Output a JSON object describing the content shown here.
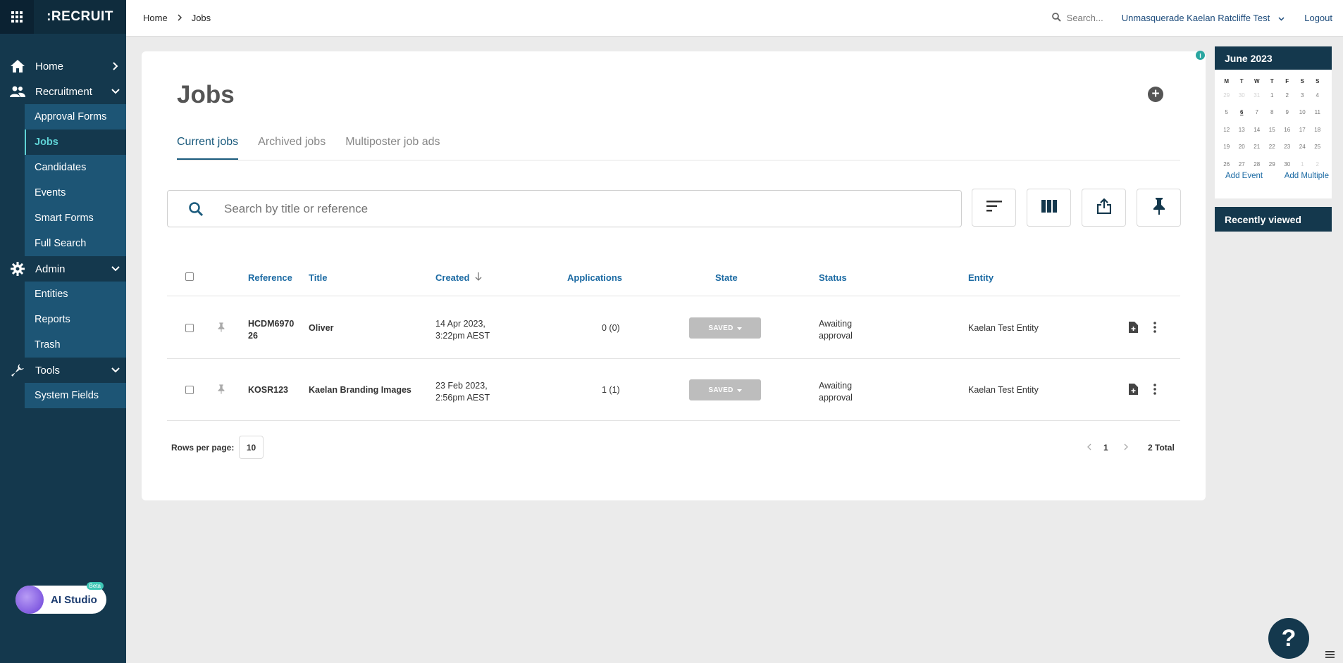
{
  "sidebar": {
    "brand": ":RECRUIT",
    "nav": [
      {
        "label": "Home"
      },
      {
        "label": "Recruitment",
        "children": [
          "Approval Forms",
          "Jobs",
          "Candidates",
          "Events",
          "Smart Forms",
          "Full Search"
        ]
      },
      {
        "label": "Admin",
        "children": [
          "Entities",
          "Reports",
          "Trash"
        ]
      },
      {
        "label": "Tools",
        "children": [
          "System Fields"
        ]
      }
    ],
    "ai_studio": {
      "label": "AI Studio",
      "badge": "Beta"
    }
  },
  "topbar": {
    "breadcrumb": [
      "Home",
      "Jobs"
    ],
    "search_placeholder": "Search...",
    "user": "Unmasquerade Kaelan Ratcliffe Test",
    "logout": "Logout"
  },
  "main": {
    "title": "Jobs",
    "tabs": [
      "Current jobs",
      "Archived jobs",
      "Multiposter job ads"
    ],
    "search_placeholder": "Search by title or reference",
    "columns": [
      "Reference",
      "Title",
      "Created",
      "Applications",
      "State",
      "Status",
      "Entity"
    ],
    "rows": [
      {
        "reference_1": "HCDM6970",
        "reference_2": "26",
        "title": "Oliver",
        "created_1": "14 Apr 2023,",
        "created_2": "3:22pm AEST",
        "applications": "0 (0)",
        "state": "SAVED",
        "status_1": "Awaiting",
        "status_2": "approval",
        "entity": "Kaelan Test Entity"
      },
      {
        "reference_1": "KOSR123",
        "reference_2": "",
        "title": "Kaelan Branding Images",
        "created_1": "23 Feb 2023,",
        "created_2": "2:56pm AEST",
        "applications": "1 (1)",
        "state": "SAVED",
        "status_1": "Awaiting",
        "status_2": "approval",
        "entity": "Kaelan Test Entity"
      }
    ],
    "pager": {
      "rows_per_page_label": "Rows per page:",
      "rows_per_page": "10",
      "page": "1",
      "total": "2 Total"
    }
  },
  "calendar": {
    "month": "June 2023",
    "day_names": [
      "M",
      "T",
      "W",
      "T",
      "F",
      "S",
      "S"
    ],
    "days": [
      "29",
      "30",
      "31",
      "1",
      "2",
      "3",
      "4",
      "5",
      "6",
      "7",
      "8",
      "9",
      "10",
      "11",
      "12",
      "13",
      "14",
      "15",
      "16",
      "17",
      "18",
      "19",
      "20",
      "21",
      "22",
      "23",
      "24",
      "25",
      "26",
      "27",
      "28",
      "29",
      "30",
      "1",
      "2"
    ],
    "add_event": "Add Event",
    "add_multiple": "Add Multiple"
  },
  "recently_viewed": "Recently viewed",
  "help": "?"
}
